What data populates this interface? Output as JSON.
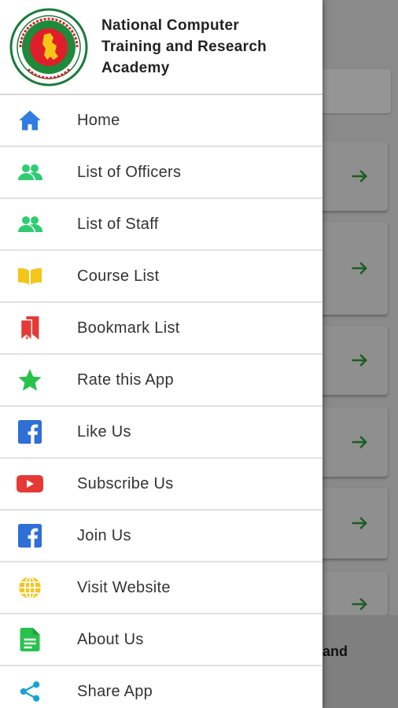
{
  "org": {
    "name_line1": "National Computer",
    "name_line2": "Training and Research",
    "name_line3": "Academy"
  },
  "menu": {
    "items": [
      {
        "label": "Home",
        "icon": "home-icon",
        "color": "#2f7de1"
      },
      {
        "label": "List of Officers",
        "icon": "people-icon",
        "color": "#2ecc71"
      },
      {
        "label": "List of Staff",
        "icon": "people-icon",
        "color": "#2ecc71"
      },
      {
        "label": "Course List",
        "icon": "book-icon",
        "color": "#f5c518"
      },
      {
        "label": "Bookmark List",
        "icon": "bookmark-icon",
        "color": "#e53935"
      },
      {
        "label": "Rate this App",
        "icon": "star-icon",
        "color": "#27c24c"
      },
      {
        "label": "Like Us",
        "icon": "facebook-icon",
        "color": "#2f6fd6"
      },
      {
        "label": "Subscribe Us",
        "icon": "youtube-icon",
        "color": "#e53935"
      },
      {
        "label": "Join Us",
        "icon": "facebook-icon",
        "color": "#2f6fd6"
      },
      {
        "label": "Visit Website",
        "icon": "globe-icon",
        "color": "#f5c518"
      },
      {
        "label": "About Us",
        "icon": "document-icon",
        "color": "#27c24c"
      },
      {
        "label": "Share App",
        "icon": "share-icon",
        "color": "#17a2d8"
      }
    ]
  },
  "background": {
    "footer_text": "and",
    "arrow_color": "#1b5e20"
  }
}
